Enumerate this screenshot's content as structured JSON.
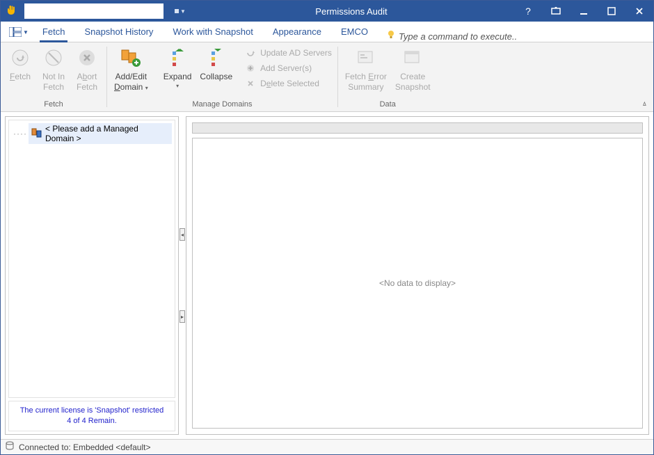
{
  "titlebar": {
    "title": "Permissions Audit"
  },
  "tabs": {
    "layout": "Layout",
    "fetch": "Fetch",
    "snapshot_history": "Snapshot History",
    "work_with_snapshot": "Work with Snapshot",
    "appearance": "Appearance",
    "emco": "EMCO",
    "exec_placeholder": "Type a command to execute.."
  },
  "ribbon": {
    "groups": {
      "fetch": "Fetch",
      "manage_domains": "Manage Domains",
      "data": "Data"
    },
    "fetch": {
      "fetch": "Fetch",
      "not_in_fetch": "Not In\nFetch",
      "abort": "Abort\nFetch"
    },
    "manage": {
      "add_edit_domain": "Add/Edit\nDomain",
      "expand": "Expand",
      "collapse": "Collapse",
      "update_ad": "Update AD Servers",
      "add_servers": "Add Server(s)",
      "delete_selected": "Delete Selected"
    },
    "data": {
      "fetch_error_summary": "Fetch Error\nSummary",
      "create_snapshot": "Create\nSnapshot"
    }
  },
  "tree": {
    "root": "< Please add a Managed Domain >"
  },
  "license": {
    "line1": "The current license is 'Snapshot' restricted",
    "line2": "4 of 4 Remain."
  },
  "grid": {
    "empty": "<No data to display>"
  },
  "statusbar": {
    "connected": "Connected to: Embedded <default>"
  }
}
